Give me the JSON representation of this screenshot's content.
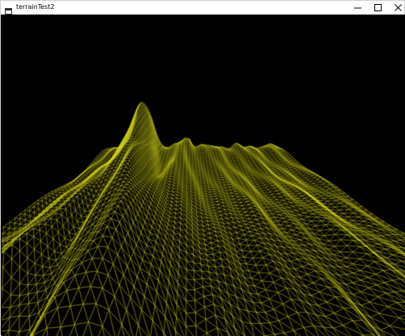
{
  "window": {
    "title": "terrainTest2",
    "app_icon": "window-icon",
    "controls": [
      "minimize-icon",
      "maximize-icon",
      "close-icon"
    ]
  },
  "viewport": {
    "content": "wireframe-terrain-mesh",
    "background_color": "#000000",
    "wire_color": "#d7d719"
  }
}
